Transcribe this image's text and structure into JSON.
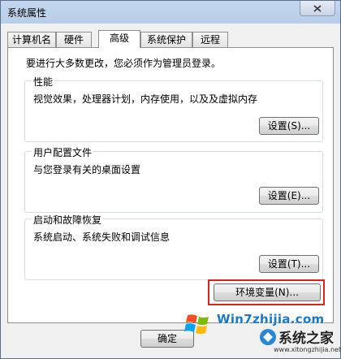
{
  "window": {
    "title": "系统属性"
  },
  "tabs": [
    {
      "label": "计算机名",
      "active": false
    },
    {
      "label": "硬件",
      "active": false
    },
    {
      "label": "高级",
      "active": true
    },
    {
      "label": "系统保护",
      "active": false
    },
    {
      "label": "远程",
      "active": false
    }
  ],
  "notice": "要进行大多数更改，您必须作为管理员登录。",
  "groups": [
    {
      "legend": "性能",
      "description": "视觉效果，处理器计划，内存使用，以及及虚拟内存",
      "button": "设置(S)..."
    },
    {
      "legend": "用户配置文件",
      "description": "与您登录有关的桌面设置",
      "button": "设置(E)..."
    },
    {
      "legend": "启动和故障恢复",
      "description": "系统启动、系统失败和调试信息",
      "button": "设置(T)..."
    }
  ],
  "env_button": "环境变量(N)...",
  "footer": {
    "ok": "确定"
  },
  "watermark": {
    "site": "Win7zhijia.com",
    "brand": "系统之家",
    "url": "www.xitongzhijia.net"
  },
  "colors": {
    "highlight": "#e0201a",
    "title_bg": "#c5d7ef"
  }
}
